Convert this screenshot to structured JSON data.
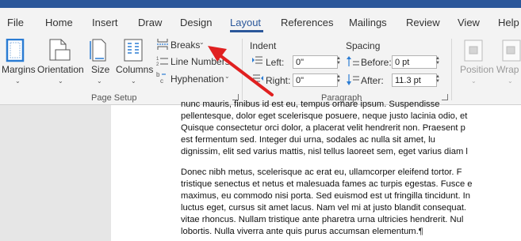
{
  "tabs": [
    "File",
    "Home",
    "Insert",
    "Draw",
    "Design",
    "Layout",
    "References",
    "Mailings",
    "Review",
    "View",
    "Help"
  ],
  "active_tab": "Layout",
  "ribbon": {
    "margins": "Margins",
    "orientation": "Orientation",
    "size": "Size",
    "columns": "Columns",
    "breaks": "Breaks",
    "line_numbers": "Line Numbers",
    "hyphenation": "Hyphenation",
    "page_setup_label": "Page Setup",
    "indent_label": "Indent",
    "left_label": "Left:",
    "left_value": "0\"",
    "right_label": "Right:",
    "right_value": "0\"",
    "spacing_label": "Spacing",
    "before_label": "Before:",
    "before_value": "0 pt",
    "after_label": "After:",
    "after_value": "11.3 pt",
    "paragraph_label": "Paragraph",
    "position": "Position",
    "wrap_text": "Wrap T"
  },
  "document": {
    "lines": [
      "nunc mauris, finibus id est eu, tempus ornare ipsum. Suspendisse",
      "pellentesque, dolor eget scelerisque posuere, neque justo lacinia odio, et",
      "Quisque consectetur orci dolor, a placerat velit hendrerit non. Praesent p",
      "est fermentum sed. Integer dui urna, sodales ac nulla sit amet, lu",
      "dignissim, elit sed varius mattis, nisl tellus laoreet sem, eget varius diam l",
      "",
      "Donec nibh metus, scelerisque ac erat eu, ullamcorper eleifend tortor. F",
      "tristique senectus et netus et malesuada fames ac turpis egestas. Fusce e",
      "maximus, eu commodo nisi porta. Sed euismod est ut fringilla tincidunt. In",
      "luctus eget, cursus sit amet lacus. Nam vel mi at justo blandit consequat.",
      "vitae rhoncus. Nullam tristique ante pharetra urna ultricies hendrerit. Nul",
      "lobortis. Nulla viverra ante quis purus accumsan elementum.¶"
    ]
  },
  "colors": {
    "accent": "#2b579a",
    "annotation_arrow": "#e02020"
  }
}
